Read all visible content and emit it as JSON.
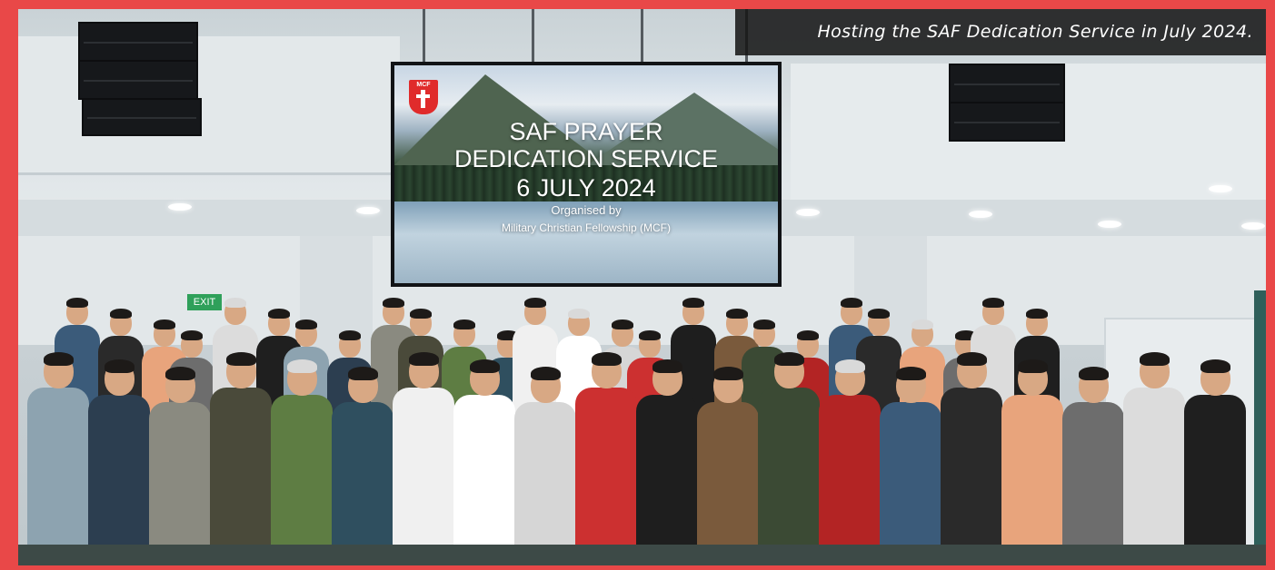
{
  "caption": {
    "text": "Hosting the SAF Dedication Service in July 2024."
  },
  "screen": {
    "logo_text": "MCF",
    "title_line1": "SAF PRAYER",
    "title_line2": "DEDICATION SERVICE",
    "date": "6 JULY 2024",
    "organised_label": "Organised by",
    "organiser": "Military Christian Fellowship (MCF)"
  },
  "exit_sign": {
    "text": "EXIT"
  },
  "colors": {
    "frame": "#e94848",
    "caption_bg": "#141414",
    "exit_sign": "#2fa05a"
  },
  "scene": {
    "description_icons": [
      "speaker-icon",
      "ceiling-light-icon"
    ]
  }
}
